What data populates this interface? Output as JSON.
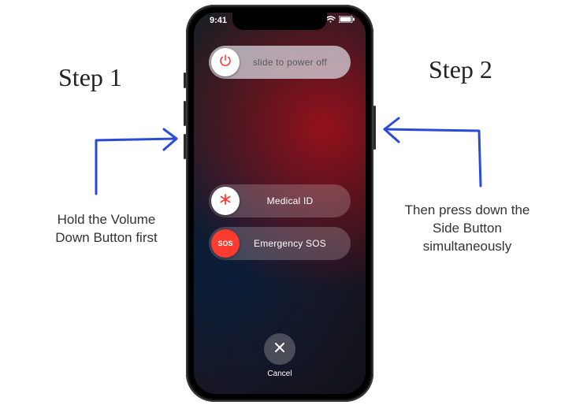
{
  "statusbar": {
    "time": "9:41"
  },
  "sliders": {
    "power": {
      "label": "slide to power off",
      "icon": "power-icon"
    },
    "medical": {
      "label": "Medical ID",
      "icon": "asterisk-icon"
    },
    "sos": {
      "label": "Emergency SOS",
      "knob_text": "SOS"
    }
  },
  "cancel": {
    "label": "Cancel"
  },
  "annotations": {
    "step1": {
      "heading": "Step 1",
      "desc": "Hold the Volume Down Button first"
    },
    "step2": {
      "heading": "Step 2",
      "desc": "Then press down the Side Button simultaneously"
    }
  },
  "colors": {
    "blue": "#2b4bd6",
    "red": "#ff3b30"
  }
}
